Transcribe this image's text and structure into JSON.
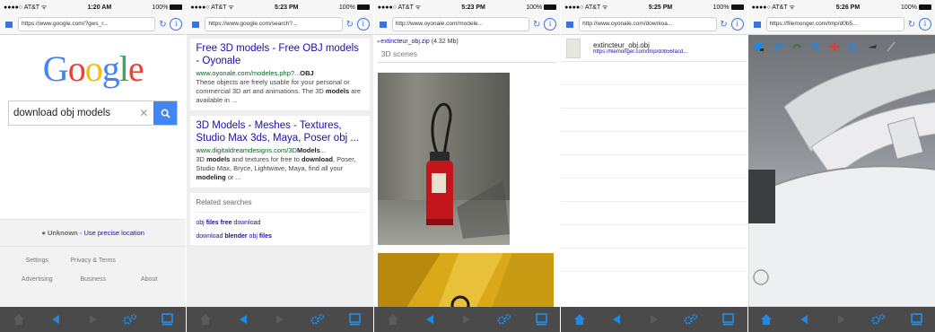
{
  "colors": {
    "link": "#1a0dab",
    "url_green": "#006621",
    "accent": "#3b73d6",
    "toolbar_bg": "#4a4a4a",
    "icon_blue": "#1e88e5"
  },
  "screens": [
    {
      "status": {
        "carrier": "●●●●○ AT&T ᯤ",
        "time": "1:20 AM",
        "battery": "100%"
      },
      "url": "https://www.google.com/?gws_r...",
      "google": {
        "logo": "Google",
        "query": "download obj models",
        "location_prefix": "Unknown - ",
        "location_link": "Use precise location",
        "footer_links": [
          "Settings",
          "Privacy & Terms",
          "",
          "Advertising",
          "Business",
          "About"
        ]
      }
    },
    {
      "status": {
        "carrier": "●●●●○ AT&T ᯤ",
        "time": "5:23 PM",
        "battery": "100%"
      },
      "url": "https://www.google.com/search?...",
      "results": [
        {
          "title": "Free 3D models - Free OBJ models - Oyonale",
          "site_pre": "www.oyonale.com/modeles.php?...",
          "site_bold": "OBJ",
          "snippet_1": "These objects are freely usable for your personal or commercial 3D art and animations. The 3D ",
          "snippet_b1": "models",
          "snippet_2": " are available in ..."
        },
        {
          "title": "3D Models - Meshes - Textures, Studio Max 3ds, Maya, Poser obj ...",
          "site_pre": "www.digitaldreamdesigns.com/3D",
          "site_bold": "Models",
          "site_post": "...",
          "snippet_1": "3D ",
          "snippet_b1": "models",
          "snippet_2": " and textures for free to ",
          "snippet_b2": "download",
          "snippet_3": ", Poser, Studio Max, Bryce, Lightwave, Maya, find all your ",
          "snippet_b3": "modeling",
          "snippet_4": " or ..."
        }
      ],
      "related": {
        "header": "Related searches",
        "items": [
          {
            "a": "obj ",
            "b": "files free",
            "c": " download"
          },
          {
            "a": "download ",
            "b": "blender",
            "c": " obj ",
            "d": "files"
          }
        ]
      }
    },
    {
      "status": {
        "carrier": "●●●●○ AT&T ᯤ",
        "time": "5:23 PM",
        "battery": "100%"
      },
      "url": "http://www.oyonale.com/modele...",
      "download_link": "extincteur_obj.zip",
      "download_size": "(4.32 Mb)",
      "section": "3D scenes"
    },
    {
      "status": {
        "carrier": "●●●●○ AT&T ᯤ",
        "time": "5:25 PM",
        "battery": "100%"
      },
      "url": "http://www.oyonale.com/downloa...",
      "file_name": "extincteur_obj.obj",
      "file_url": "https://filemonger.com/tmp/d0b56facd..."
    },
    {
      "status": {
        "carrier": "●●●●○ AT&T ᯤ",
        "time": "5:26 PM",
        "battery": "100%"
      },
      "url": "https://filemonger.com/tmp/d0b5..."
    }
  ]
}
